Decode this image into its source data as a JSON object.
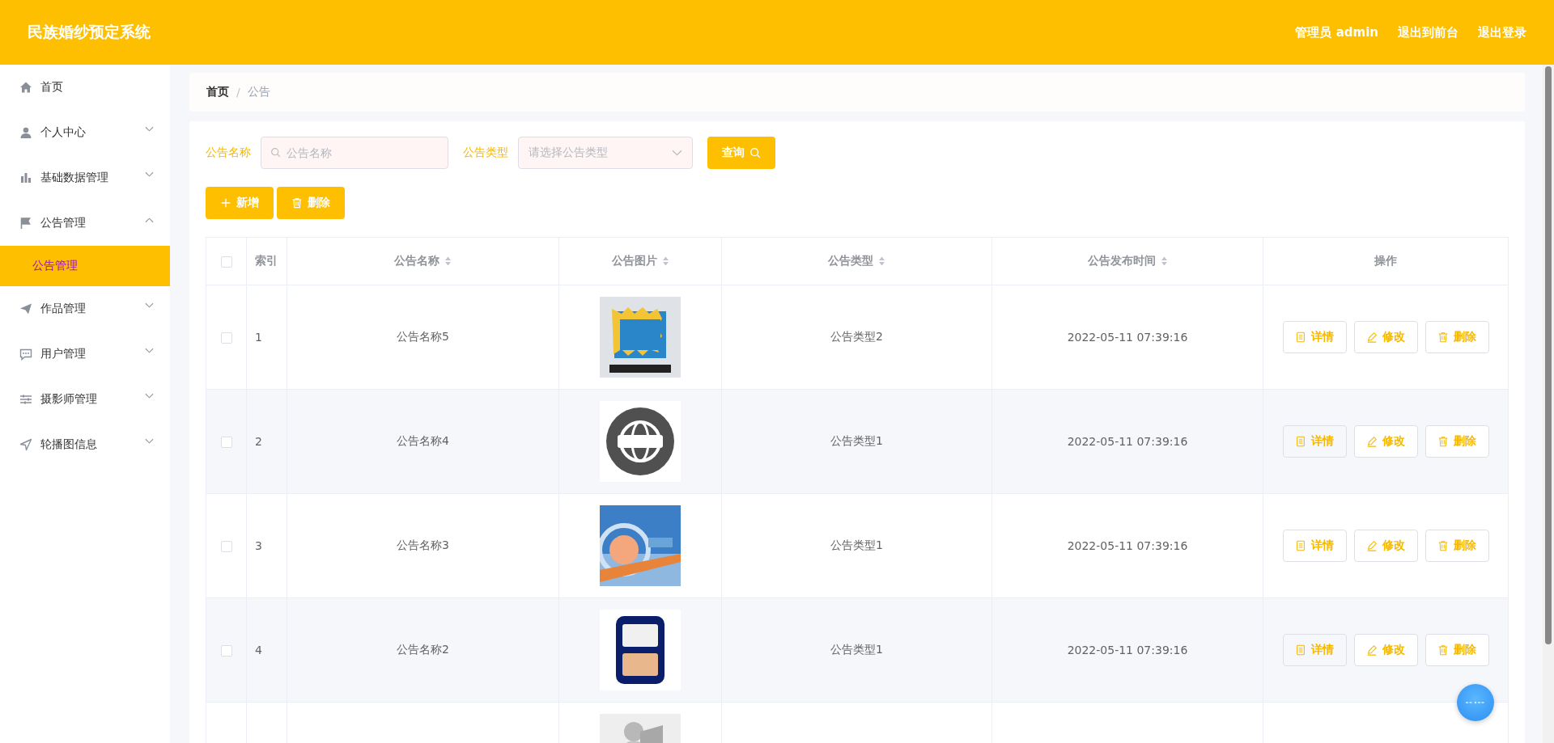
{
  "header": {
    "title": "民族婚纱预定系统",
    "links": [
      "管理员 admin",
      "退出到前台",
      "退出登录"
    ]
  },
  "sidebar": {
    "items": [
      {
        "label": "首页"
      },
      {
        "label": "个人中心",
        "expanded": false
      },
      {
        "label": "基础数据管理",
        "expanded": false
      },
      {
        "label": "公告管理",
        "expanded": true,
        "children": [
          {
            "label": "公告管理",
            "selected": true
          }
        ]
      },
      {
        "label": "作品管理",
        "expanded": false
      },
      {
        "label": "用户管理",
        "expanded": false
      },
      {
        "label": "摄影师管理",
        "expanded": false
      },
      {
        "label": "轮播图信息",
        "expanded": false
      }
    ]
  },
  "breadcrumb": {
    "separator": "/",
    "items": [
      "首页",
      "公告"
    ]
  },
  "search": {
    "fields": [
      {
        "kind": "text",
        "label": "公告名称",
        "placeholder": "公告名称"
      },
      {
        "kind": "select",
        "label": "公告类型",
        "placeholder": "请选择公告类型"
      }
    ],
    "button": "查询"
  },
  "actions": [
    "新增",
    "删除"
  ],
  "table": {
    "all_checked": false,
    "columns": [
      {
        "label": "索引",
        "sortable": false
      },
      {
        "label": "公告名称",
        "sortable": true
      },
      {
        "label": "公告图片",
        "sortable": true
      },
      {
        "label": "公告类型",
        "sortable": true
      },
      {
        "label": "公告发布时间",
        "sortable": true
      },
      {
        "label": "操作",
        "sortable": false
      }
    ],
    "rows": [
      {
        "checked": false,
        "index": "1",
        "name": "公告名称5",
        "image": {
          "kind": "picture"
        },
        "type": "公告类型2",
        "time": "2022-05-11 07:39:16",
        "actions": [
          "详情",
          "修改",
          "删除"
        ]
      },
      {
        "checked": false,
        "index": "2",
        "name": "公告名称4",
        "image": {
          "kind": "picture"
        },
        "type": "公告类型1",
        "time": "2022-05-11 07:39:16",
        "actions": [
          "详情",
          "修改",
          "删除"
        ]
      },
      {
        "checked": false,
        "index": "3",
        "name": "公告名称3",
        "image": {
          "kind": "picture"
        },
        "type": "公告类型1",
        "time": "2022-05-11 07:39:16",
        "actions": [
          "详情",
          "修改",
          "删除"
        ]
      },
      {
        "checked": false,
        "index": "4",
        "name": "公告名称2",
        "image": {
          "kind": "picture"
        },
        "type": "公告类型1",
        "time": "2022-05-11 07:39:16",
        "actions": [
          "详情",
          "修改",
          "删除"
        ]
      },
      {
        "image": {
          "kind": "picture"
        }
      }
    ]
  }
}
